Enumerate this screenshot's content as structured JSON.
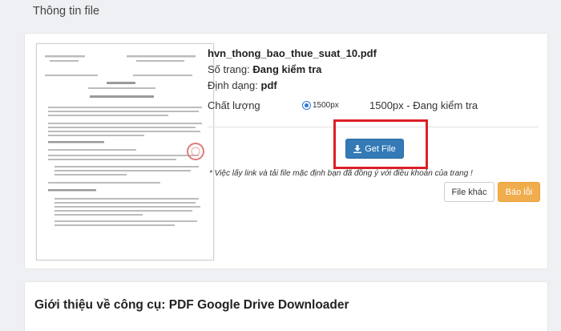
{
  "section": {
    "title": "Thông tin file"
  },
  "file": {
    "name": "hvn_thong_bao_thue_suat_10.pdf",
    "pages_label": "Số trang:",
    "pages_value": "Đang kiểm tra",
    "format_label": "Định dạng:",
    "format_value": "pdf",
    "quality_label": "Chất lượng",
    "quality_option": "1500px",
    "quality_status": "1500px - Đang kiểm tra"
  },
  "actions": {
    "get_file_label": "Get File",
    "notice": "* Việc lấy link và tải file mặc định bạn đã đồng ý với điều khoản của trang !",
    "other_file_label": "File khác",
    "report_label": "Báo lỗi"
  },
  "intro": {
    "title": "Giới thiệu về công cụ: PDF Google Drive Downloader"
  },
  "colors": {
    "primary": "#337ab7",
    "warning": "#f0ad4e",
    "highlight": "#dd1f26"
  },
  "icons": {
    "download": "download-icon"
  }
}
